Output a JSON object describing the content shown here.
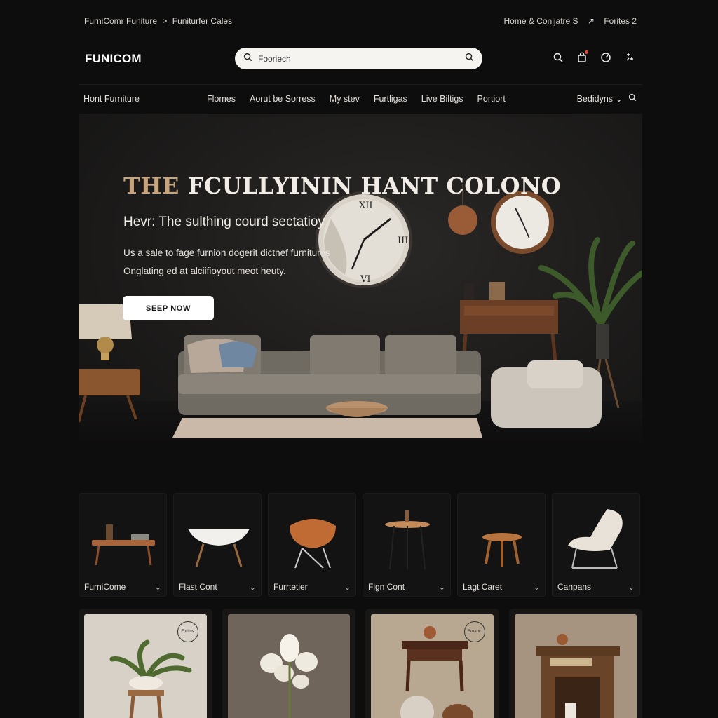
{
  "utility": {
    "breadcrumb_1": "FurniComr Funiture",
    "breadcrumb_sep": ">",
    "breadcrumb_2": "Funiturfer Cales",
    "right_1": "Home & Conijatre S",
    "right_sep": "↗",
    "right_2": "Forites 2"
  },
  "header": {
    "logo": "FUNICOM",
    "search_value": "Fooriech",
    "icons": [
      "search-icon",
      "bag-icon",
      "compass-icon",
      "menu-icon"
    ]
  },
  "nav": {
    "home": "Hont Furniture",
    "links": [
      "Flomes",
      "Aorut be Sorress",
      "My stev",
      "Furtligas",
      "Live Biltigs",
      "Portiort"
    ],
    "right": "Bedidyns",
    "right_chevron": "⌄"
  },
  "hero": {
    "title_a": "THE",
    "title_b": "FCULLYININ HANT COLONO",
    "subtitle": "Hevr: The sulthing courd sectatioy",
    "desc_1": "Us a sale to fage furnion dogerit dictnef furnitures",
    "desc_2": "Onglating ed at alciifioyout meot heuty.",
    "cta": "SEEP NOW"
  },
  "categories": [
    {
      "label": "FurniCome",
      "icon": "coffee-table"
    },
    {
      "label": "Flast Cont",
      "icon": "bowl-table"
    },
    {
      "label": "Furrtetier",
      "icon": "shell-chair"
    },
    {
      "label": "Fign Cont",
      "icon": "bar-table"
    },
    {
      "label": "Lagt Caret",
      "icon": "stool"
    },
    {
      "label": "Canpans",
      "icon": "lounge-chair"
    }
  ],
  "products": [
    {
      "name": "plant-on-stool",
      "stamp": "Foritns"
    },
    {
      "name": "white-tulips",
      "stamp": ""
    },
    {
      "name": "side-table-decor",
      "stamp": "Broanc"
    },
    {
      "name": "vintage-fireplace",
      "stamp": ""
    }
  ],
  "colors": {
    "background": "#0e0d0d",
    "accent": "#c7a47b",
    "cta_bg": "#ffffff",
    "notification": "#e0483b"
  }
}
